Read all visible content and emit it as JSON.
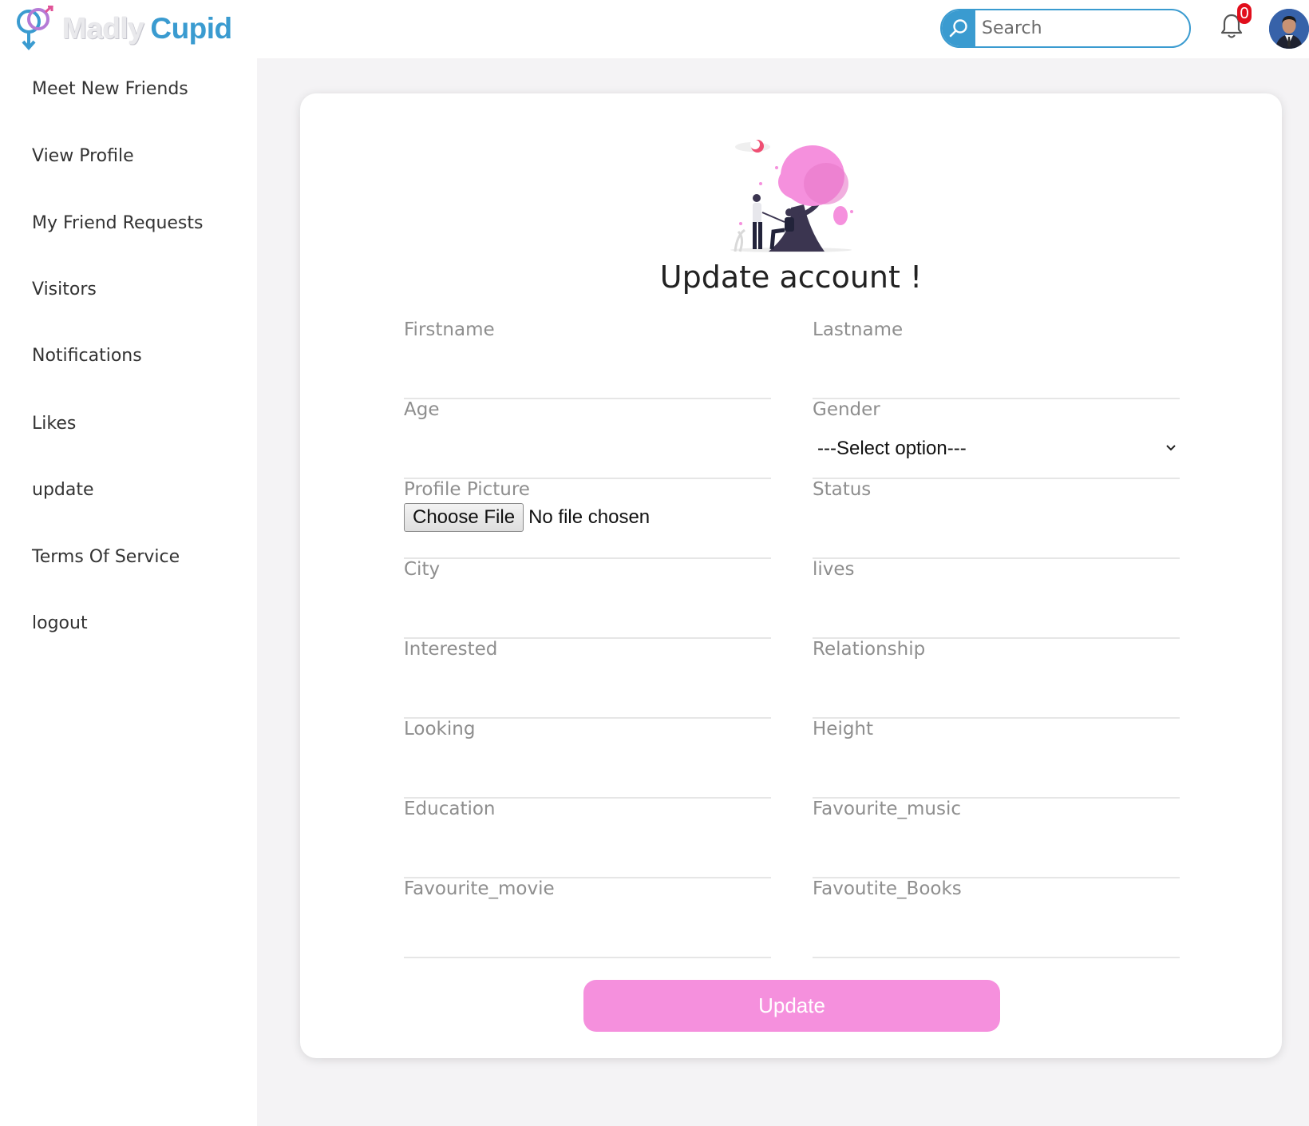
{
  "brand": {
    "name_part1": "Madly",
    "name_part2": "Cupid"
  },
  "search": {
    "placeholder": "Search",
    "icon": "search-icon"
  },
  "notifications": {
    "count": "0",
    "icon": "bell-icon"
  },
  "sidebar": {
    "items": [
      {
        "label": "Meet New Friends"
      },
      {
        "label": "View Profile"
      },
      {
        "label": "My Friend Requests"
      },
      {
        "label": "Visitors"
      },
      {
        "label": "Notifications"
      },
      {
        "label": "Likes"
      },
      {
        "label": "update"
      },
      {
        "label": "Terms Of Service"
      },
      {
        "label": "logout"
      }
    ]
  },
  "form": {
    "title": "Update account !",
    "fields": {
      "firstname": "Firstname",
      "lastname": "Lastname",
      "age": "Age",
      "gender": "Gender",
      "gender_selected": "---Select option---",
      "profile_picture": "Profile Picture",
      "file_button": "Choose File",
      "file_status": "No file chosen",
      "status": "Status",
      "city": "City",
      "lives": "lives",
      "interested": "Interested",
      "relationship": "Relationship",
      "looking": "Looking",
      "height": "Height",
      "education": "Education",
      "favourite_music": "Favourite_music",
      "favourite_movie": "Favourite_movie",
      "favourite_books": "Favoutite_Books"
    },
    "submit_label": "Update"
  },
  "colors": {
    "brand_blue": "#3a9bd0",
    "button_pink": "#f590dd",
    "badge_red": "#e10e1c"
  }
}
